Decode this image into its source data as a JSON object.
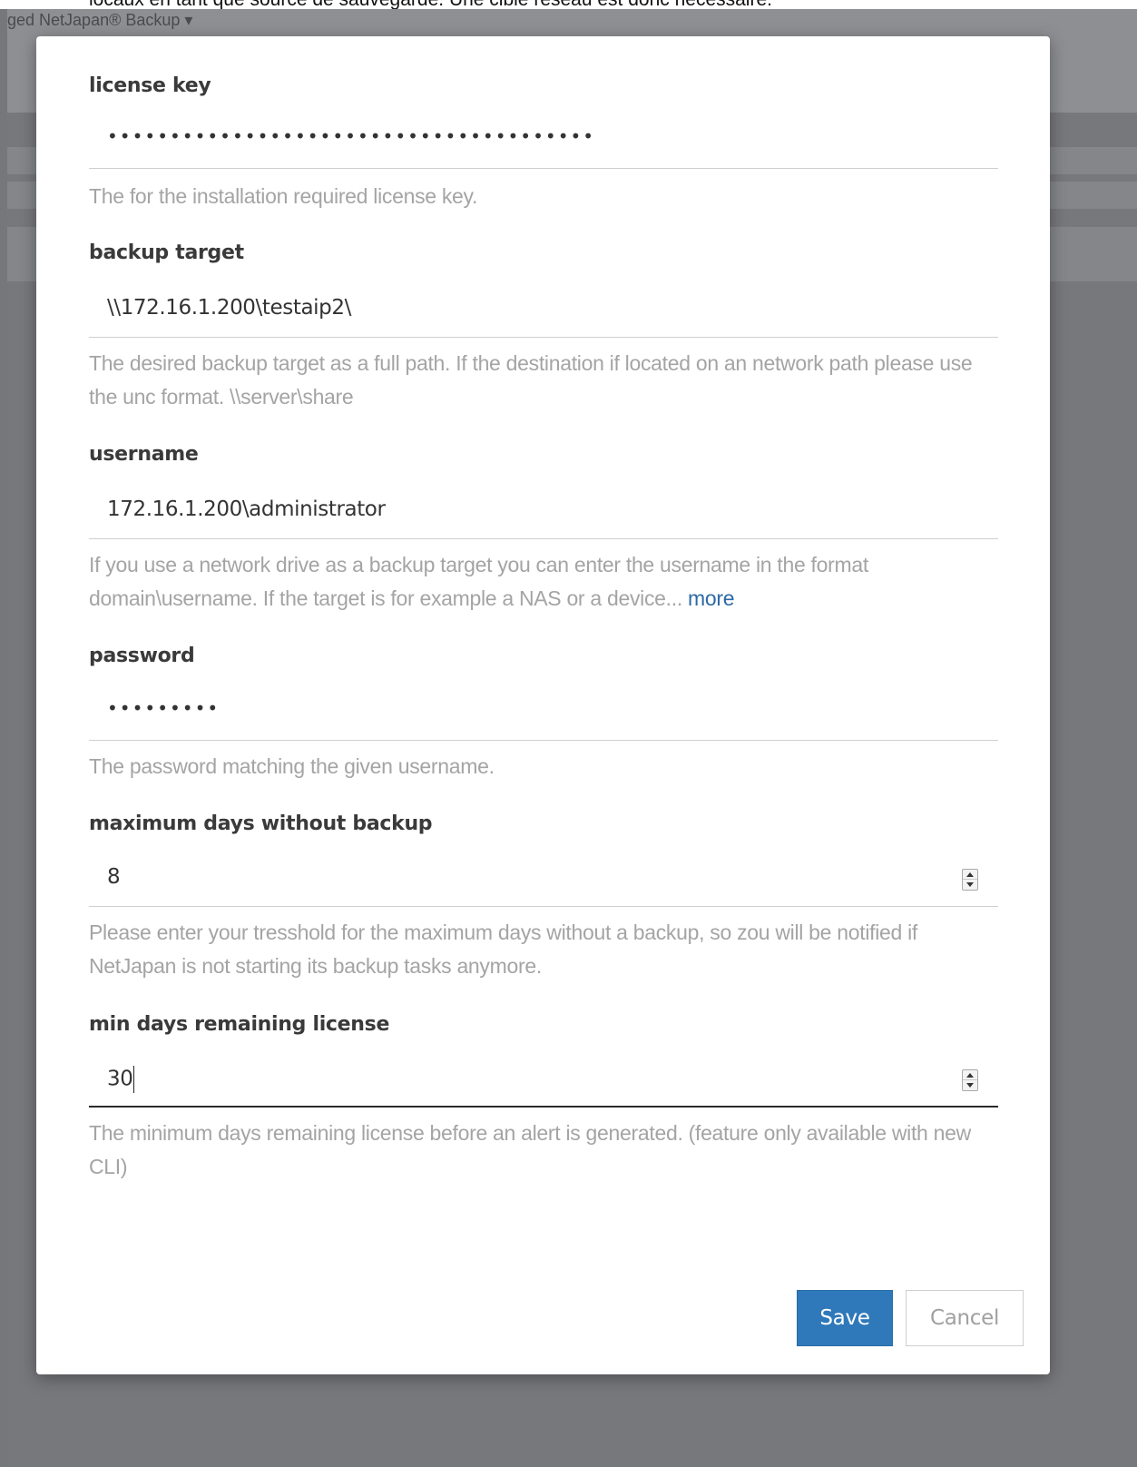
{
  "page_caption": "locaux en tant que source de sauvegarde. Une cible réseau est donc nécessaire.",
  "background": {
    "breadcrumb": "ged NetJapan® Backup ▾"
  },
  "fields": [
    {
      "label": "license key",
      "value": "•••••••••••••••••••••••••••••••••••••••",
      "help": "The for the installation required license key."
    },
    {
      "label": "backup target",
      "value": "\\\\172.16.1.200\\testaip2\\",
      "help": "The desired backup target as a full path. If the destination if located on an network path please use the unc format. \\\\server\\share"
    },
    {
      "label": "username",
      "value": "172.16.1.200\\administrator",
      "help": "If you use a network drive as a backup target you can enter the username in the format domain\\username. If the target is for example a NAS or a device...",
      "more": "more"
    },
    {
      "label": "password",
      "value": "•••••••••",
      "help": "The password matching the given username."
    },
    {
      "label": "maximum days without backup",
      "value": "8",
      "help": "Please enter your tresshold for the maximum days without a backup, so zou will be notified if NetJapan is not starting its backup tasks anymore."
    },
    {
      "label": "min days remaining license",
      "value": "30",
      "help": "The minimum days remaining license before an alert is generated. (feature only available with new CLI)"
    }
  ],
  "buttons": {
    "save": "Save",
    "cancel": "Cancel"
  },
  "colors": {
    "primary": "#2f79ba",
    "link": "#2c6aa5",
    "overlay": "#76777b"
  }
}
